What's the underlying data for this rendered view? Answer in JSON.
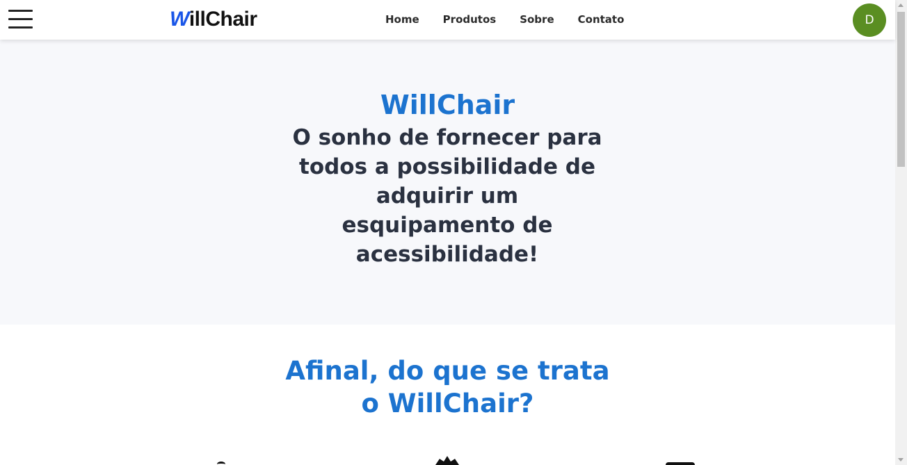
{
  "header": {
    "logo_first_letter": "W",
    "logo_rest": "illChair",
    "nav": [
      {
        "label": "Home"
      },
      {
        "label": "Produtos"
      },
      {
        "label": "Sobre"
      },
      {
        "label": "Contato"
      }
    ],
    "avatar_initial": "D",
    "avatar_color": "#5a8e22"
  },
  "hero": {
    "title": "WillChair",
    "subtitle": "O sonho de fornecer para todos a possibilidade de adquirir um esquipamento de acessibilidade!"
  },
  "about": {
    "title": "Afinal, do que se trata o WillChair?"
  },
  "colors": {
    "accent": "#1c73cf",
    "text_dark": "#2a3140",
    "hero_bg": "#f7f8fb",
    "logo_blue": "#1a56e8"
  }
}
